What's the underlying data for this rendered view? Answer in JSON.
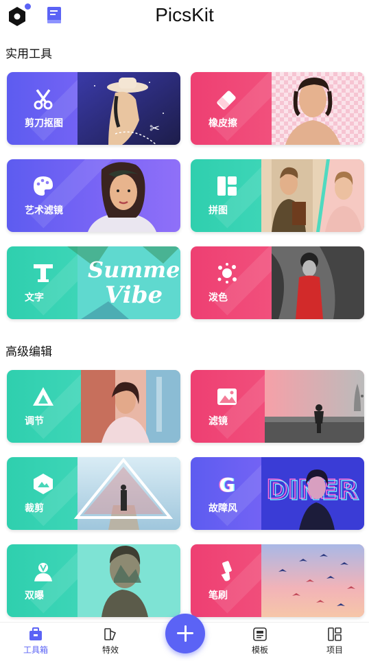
{
  "header": {
    "title": "PicsKit"
  },
  "sections": [
    {
      "title": "实用工具",
      "cards": [
        {
          "label": "剪刀抠图",
          "icon": "scissors-icon",
          "theme": "blue"
        },
        {
          "label": "橡皮擦",
          "icon": "eraser-icon",
          "theme": "pink"
        },
        {
          "label": "艺术滤镜",
          "icon": "palette-icon",
          "theme": "blue"
        },
        {
          "label": "拼图",
          "icon": "collage-icon",
          "theme": "teal"
        },
        {
          "label": "文字",
          "icon": "text-icon",
          "theme": "teal"
        },
        {
          "label": "泼色",
          "icon": "splash-icon",
          "theme": "pink"
        }
      ]
    },
    {
      "title": "高级编辑",
      "cards": [
        {
          "label": "调节",
          "icon": "adjust-icon",
          "theme": "teal"
        },
        {
          "label": "滤镜",
          "icon": "filter-icon",
          "theme": "pink"
        },
        {
          "label": "裁剪",
          "icon": "crop-icon",
          "theme": "teal"
        },
        {
          "label": "故障风",
          "icon": "glitch-icon",
          "theme": "blue"
        },
        {
          "label": "双曝",
          "icon": "double-exposure-icon",
          "theme": "teal"
        },
        {
          "label": "笔刷",
          "icon": "brush-icon",
          "theme": "pink"
        }
      ]
    }
  ],
  "bottom_nav": {
    "tabs": [
      {
        "label": "工具箱",
        "icon": "toolbox-icon",
        "active": true
      },
      {
        "label": "特效",
        "icon": "effects-icon",
        "active": false
      },
      {
        "label": "模板",
        "icon": "template-icon",
        "active": false
      },
      {
        "label": "项目",
        "icon": "project-icon",
        "active": false
      }
    ],
    "fab_icon": "plus-icon"
  },
  "colors": {
    "accent": "#5b63f5",
    "blue_card": "#6a5ff3",
    "pink_card": "#f04a78",
    "teal_card": "#3bd4b4"
  }
}
